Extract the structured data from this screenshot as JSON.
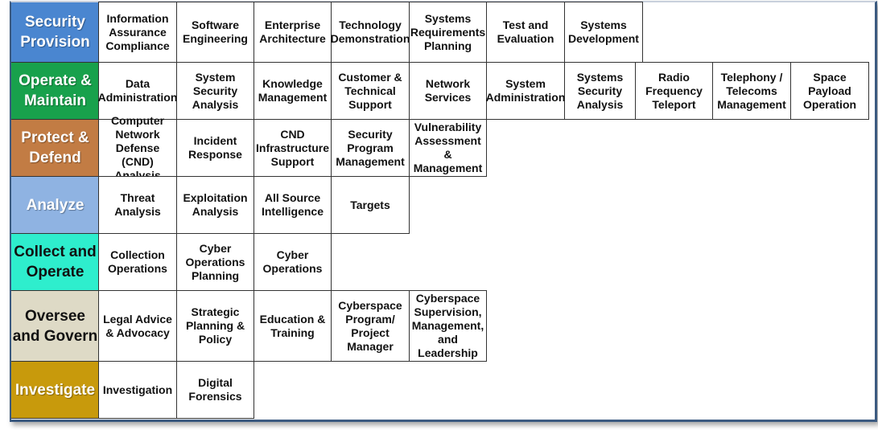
{
  "rows": [
    {
      "category": "Security Provision",
      "color": "#4a86d0",
      "text_color": "#ffffff",
      "items": [
        "Information Assurance Compliance",
        "Software Engineering",
        "Enterprise Architecture",
        "Technology Demonstration",
        "Systems Requirements Planning",
        "Test and Evaluation",
        "Systems Development"
      ]
    },
    {
      "category": "Operate & Maintain",
      "color": "#18a14c",
      "text_color": "#ffffff",
      "items": [
        "Data Administration",
        "System Security Analysis",
        "Knowledge Management",
        "Customer & Technical Support",
        "Network Services",
        "System Administration",
        "Systems Security Analysis",
        "Radio Frequency Teleport",
        "Telephony / Telecoms Management",
        "Space Payload Operation"
      ]
    },
    {
      "category": "Protect & Defend",
      "color": "#c27c44",
      "text_color": "#ffffff",
      "items": [
        "Computer Network Defense (CND) Analysis",
        "Incident Response",
        "CND Infrastructure Support",
        "Security Program Management",
        "Vulnerability Assessment & Management"
      ]
    },
    {
      "category": "Analyze",
      "color": "#8fb3e2",
      "text_color": "#ffffff",
      "items": [
        "Threat Analysis",
        "Exploitation Analysis",
        "All Source Intelligence",
        "Targets"
      ]
    },
    {
      "category": "Collect and Operate",
      "color": "#2eeecd",
      "text_color": "#111111",
      "items": [
        "Collection Operations",
        "Cyber Operations Planning",
        "Cyber Operations"
      ]
    },
    {
      "category": "Oversee and Govern",
      "color": "#dedac6",
      "text_color": "#111111",
      "items": [
        "Legal Advice & Advocacy",
        "Strategic Planning & Policy",
        "Education & Training",
        "Cyberspace Program/ Project Manager",
        "Cyberspace Supervision, Management, and Leadership"
      ]
    },
    {
      "category": "Investigate",
      "color": "#c89a0c",
      "text_color": "#ffffff",
      "items": [
        "Investigation",
        "Digital Forensics"
      ]
    }
  ]
}
